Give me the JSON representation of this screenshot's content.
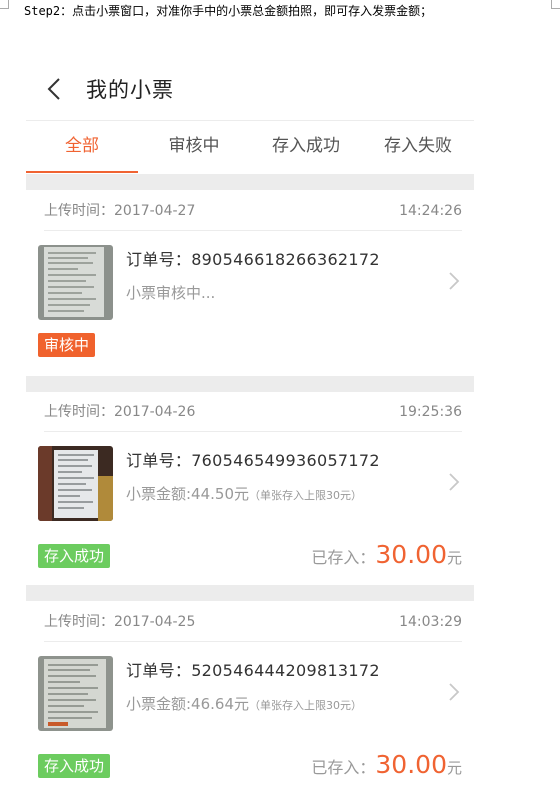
{
  "caption": "Step2：点击小票窗口，对准你手中的小票总金额拍照，即可存入发票金额；",
  "header": {
    "title": "我的小票"
  },
  "tabs": [
    {
      "label": "全部",
      "active": true
    },
    {
      "label": "审核中",
      "active": false
    },
    {
      "label": "存入成功",
      "active": false
    },
    {
      "label": "存入失败",
      "active": false
    }
  ],
  "receipts": [
    {
      "upload_label": "上传时间：",
      "date": "2017-04-27",
      "time": "14:24:26",
      "order_label": "订单号：",
      "order_no": "890546618266362172",
      "status_text": "小票审核中...",
      "badge": "审核中",
      "badge_color": "#f0622d"
    },
    {
      "upload_label": "上传时间：",
      "date": "2017-04-26",
      "time": "19:25:36",
      "order_label": "订单号：",
      "order_no": "760546549936057172",
      "amount_text": "小票金额:44.50元",
      "limit_note": "（单张存入上限30元）",
      "badge": "存入成功",
      "badge_color": "#6ccc5f",
      "saved_label": "已存入：",
      "saved_amount": "30.00",
      "saved_unit": "元"
    },
    {
      "upload_label": "上传时间：",
      "date": "2017-04-25",
      "time": "14:03:29",
      "order_label": "订单号：",
      "order_no": "520546444209813172",
      "amount_text": "小票金额:46.64元",
      "limit_note": "（单张存入上限30元）",
      "badge": "存入成功",
      "badge_color": "#6ccc5f",
      "saved_label": "已存入：",
      "saved_amount": "30.00",
      "saved_unit": "元"
    }
  ],
  "icons": [
    "back-chevron-icon",
    "chevron-right-icon"
  ],
  "accent_color": "#f06332"
}
